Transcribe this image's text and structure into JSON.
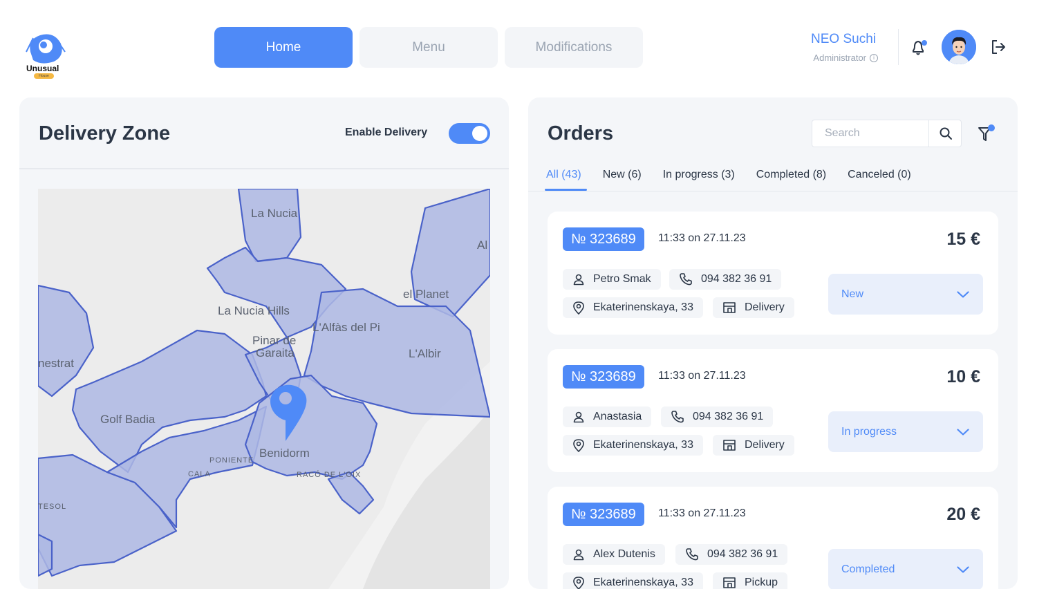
{
  "brand": {
    "name": "Unusual",
    "badge": "House"
  },
  "nav": {
    "home": "Home",
    "menu": "Menu",
    "modifications": "Modifications"
  },
  "user": {
    "name": "NEO Suchi",
    "role": "Administrator"
  },
  "colors": {
    "accent": "#4f8af7",
    "panel": "#f4f6f9",
    "zone_fill": "#aeb9e4",
    "zone_stroke": "#4a62c9"
  },
  "delivery": {
    "title": "Delivery Zone",
    "enable_label": "Enable Delivery",
    "enabled": true,
    "map_labels": {
      "la_nucia": "La Nucia",
      "la_nucia_hills": "La Nucia Hills",
      "el_planet": "el Planet",
      "alfas": "L'Alfàs del Pi",
      "pinar1": "Pinar de",
      "pinar2": "Garaita",
      "albir": "L'Albir",
      "golf": "Golf Badia",
      "benidorm": "Benidorm",
      "poniente": "PONIENTE",
      "cala": "CALA",
      "raco": "RACÓ DE L'OIX",
      "tesol": "TESOL",
      "nestrat": "nestrat",
      "al": "Al"
    }
  },
  "orders": {
    "title": "Orders",
    "search_placeholder": "Search",
    "tabs": [
      {
        "label": "All (43)",
        "active": true
      },
      {
        "label": "New (6)",
        "active": false
      },
      {
        "label": "In progress (3)",
        "active": false
      },
      {
        "label": "Completed (8)",
        "active": false
      },
      {
        "label": "Canceled (0)",
        "active": false
      }
    ],
    "items": [
      {
        "number": "№ 323689",
        "time": "11:33 on 27.11.23",
        "price": "15  €",
        "customer": "Petro Smak",
        "phone": "094 382 36 91",
        "address": "Ekaterinenskaya, 33",
        "method": "Delivery",
        "status": "New"
      },
      {
        "number": "№ 323689",
        "time": "11:33 on 27.11.23",
        "price": "10  €",
        "customer": "Anastasia",
        "phone": "094 382 36 91",
        "address": "Ekaterinenskaya, 33",
        "method": "Delivery",
        "status": "In progress"
      },
      {
        "number": "№ 323689",
        "time": "11:33 on 27.11.23",
        "price": "20  €",
        "customer": "Alex Dutenis",
        "phone": "094 382 36 91",
        "address": "Ekaterinenskaya, 33",
        "method": "Pickup",
        "status": "Completed"
      }
    ]
  }
}
